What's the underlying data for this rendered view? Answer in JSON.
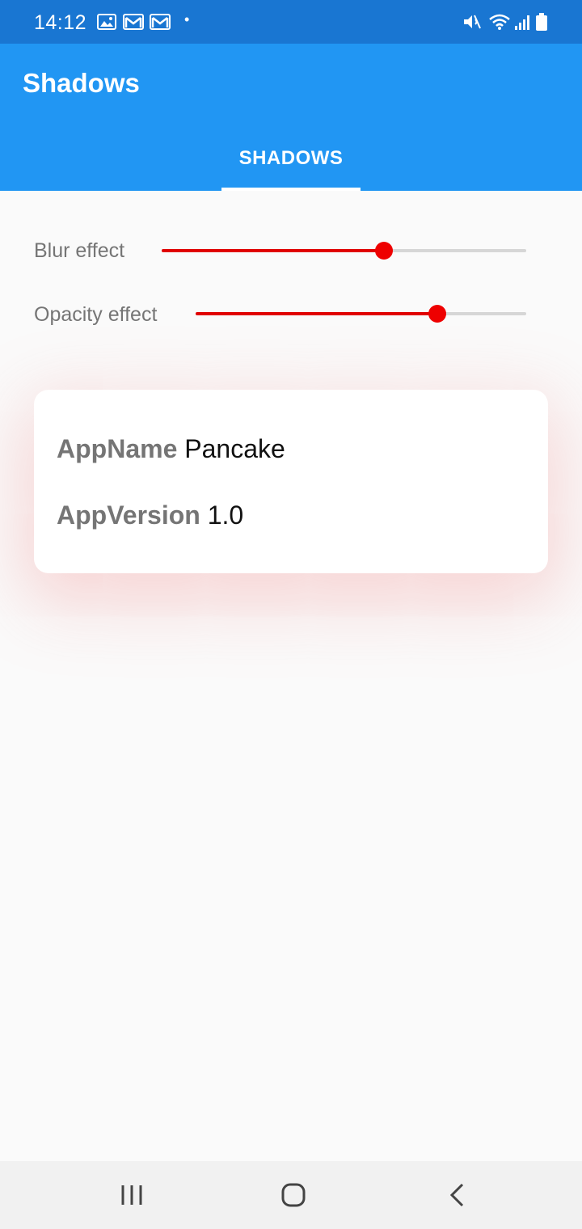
{
  "status_bar": {
    "time": "14:12",
    "left_icons": [
      "gallery-icon",
      "gmail-icon",
      "gmail-icon"
    ],
    "right_icons": [
      "mute-icon",
      "wifi-icon",
      "signal-icon",
      "battery-icon"
    ]
  },
  "app_bar": {
    "title": "Shadows",
    "tabs": [
      {
        "label": "SHADOWS",
        "selected": true
      }
    ]
  },
  "sliders": [
    {
      "label": "Blur effect",
      "value": 0.61
    },
    {
      "label": "Opacity effect",
      "value": 0.73
    }
  ],
  "card": {
    "rows": [
      {
        "key": "AppName",
        "value": "Pancake"
      },
      {
        "key": "AppVersion",
        "value": "1.0"
      }
    ]
  },
  "nav_bar": {
    "buttons": [
      "recent-apps-icon",
      "home-icon",
      "back-icon"
    ]
  },
  "colors": {
    "status_bar": "#1976d2",
    "app_bar": "#2196f3",
    "slider_accent": "#e00000",
    "shadow": "#f07878"
  }
}
